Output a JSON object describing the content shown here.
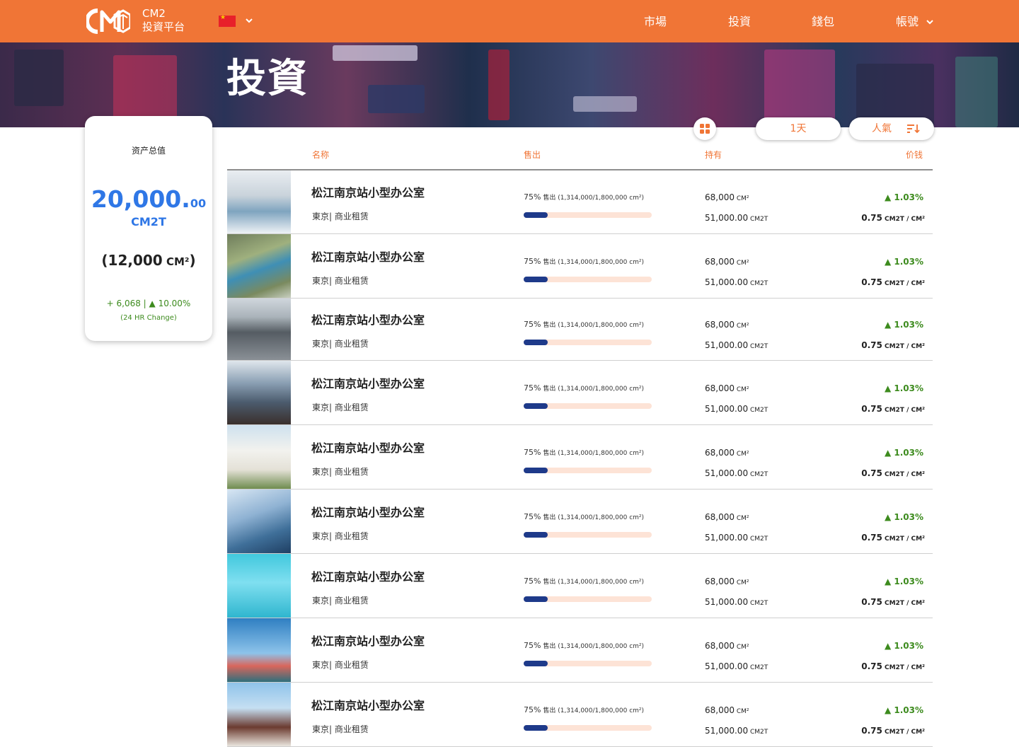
{
  "nav": {
    "brand_line1": "CM2",
    "brand_line2": "投資平台",
    "items": [
      {
        "label": "市場"
      },
      {
        "label": "投資"
      },
      {
        "label": "錢包"
      },
      {
        "label": "帳號"
      }
    ]
  },
  "hero": {
    "title": "投資"
  },
  "summary": {
    "label": "资产总值",
    "value_int": "20,000",
    "value_dot": ".",
    "value_dec": "00",
    "unit": "CM2T",
    "area_value": "(12,000",
    "area_unit": " CM²",
    "area_close": ")",
    "change_text": "+ 6,068 | ▲ 10.00%",
    "change_note": "(24 HR Change)"
  },
  "controls": {
    "period": "1天",
    "sort_label": "人氣"
  },
  "table": {
    "headers": {
      "name": "名称",
      "sold": "售出",
      "holding": "持有",
      "price": "价钱"
    },
    "rows": [
      {
        "title": "松江南京站小型办公室",
        "location": "東京| 商业租赁",
        "sold_pct": "75%",
        "sold_word": " 售出",
        "sold_detail": "  (1,314,000/1,800,000 cm²)",
        "progress": 0.19,
        "area": "68,000",
        "area_unit": " CM²",
        "tokens": "51,000.00",
        "tokens_unit": " CM2T",
        "change": "▲ 1.03%",
        "price": "0.75",
        "price_unit": " CM2T / CM²"
      },
      {
        "title": "松江南京站小型办公室",
        "location": "東京| 商业租赁",
        "sold_pct": "75%",
        "sold_word": " 售出",
        "sold_detail": "  (1,314,000/1,800,000 cm²)",
        "progress": 0.19,
        "area": "68,000",
        "area_unit": " CM²",
        "tokens": "51,000.00",
        "tokens_unit": " CM2T",
        "change": "▲ 1.03%",
        "price": "0.75",
        "price_unit": " CM2T / CM²"
      },
      {
        "title": "松江南京站小型办公室",
        "location": "東京| 商业租赁",
        "sold_pct": "75%",
        "sold_word": " 售出",
        "sold_detail": "  (1,314,000/1,800,000 cm²)",
        "progress": 0.19,
        "area": "68,000",
        "area_unit": " CM²",
        "tokens": "51,000.00",
        "tokens_unit": " CM2T",
        "change": "▲ 1.03%",
        "price": "0.75",
        "price_unit": " CM2T / CM²"
      },
      {
        "title": "松江南京站小型办公室",
        "location": "東京| 商业租赁",
        "sold_pct": "75%",
        "sold_word": " 售出",
        "sold_detail": "  (1,314,000/1,800,000 cm²)",
        "progress": 0.19,
        "area": "68,000",
        "area_unit": " CM²",
        "tokens": "51,000.00",
        "tokens_unit": " CM2T",
        "change": "▲ 1.03%",
        "price": "0.75",
        "price_unit": " CM2T / CM²"
      },
      {
        "title": "松江南京站小型办公室",
        "location": "東京| 商业租赁",
        "sold_pct": "75%",
        "sold_word": " 售出",
        "sold_detail": "  (1,314,000/1,800,000 cm²)",
        "progress": 0.19,
        "area": "68,000",
        "area_unit": " CM²",
        "tokens": "51,000.00",
        "tokens_unit": " CM2T",
        "change": "▲ 1.03%",
        "price": "0.75",
        "price_unit": " CM2T / CM²"
      },
      {
        "title": "松江南京站小型办公室",
        "location": "東京| 商业租赁",
        "sold_pct": "75%",
        "sold_word": " 售出",
        "sold_detail": "  (1,314,000/1,800,000 cm²)",
        "progress": 0.19,
        "area": "68,000",
        "area_unit": " CM²",
        "tokens": "51,000.00",
        "tokens_unit": " CM2T",
        "change": "▲ 1.03%",
        "price": "0.75",
        "price_unit": " CM2T / CM²"
      },
      {
        "title": "松江南京站小型办公室",
        "location": "東京| 商业租赁",
        "sold_pct": "75%",
        "sold_word": " 售出",
        "sold_detail": "  (1,314,000/1,800,000 cm²)",
        "progress": 0.19,
        "area": "68,000",
        "area_unit": " CM²",
        "tokens": "51,000.00",
        "tokens_unit": " CM2T",
        "change": "▲ 1.03%",
        "price": "0.75",
        "price_unit": " CM2T / CM²"
      },
      {
        "title": "松江南京站小型办公室",
        "location": "東京| 商业租赁",
        "sold_pct": "75%",
        "sold_word": " 售出",
        "sold_detail": "  (1,314,000/1,800,000 cm²)",
        "progress": 0.19,
        "area": "68,000",
        "area_unit": " CM²",
        "tokens": "51,000.00",
        "tokens_unit": " CM2T",
        "change": "▲ 1.03%",
        "price": "0.75",
        "price_unit": " CM2T / CM²"
      },
      {
        "title": "松江南京站小型办公室",
        "location": "東京| 商业租赁",
        "sold_pct": "75%",
        "sold_word": " 售出",
        "sold_detail": "  (1,314,000/1,800,000 cm²)",
        "progress": 0.19,
        "area": "68,000",
        "area_unit": " CM²",
        "tokens": "51,000.00",
        "tokens_unit": " CM2T",
        "change": "▲ 1.03%",
        "price": "0.75",
        "price_unit": " CM2T / CM²"
      }
    ]
  },
  "colors": {
    "brand_orange": "#f07536",
    "accent_blue": "#2f77e6",
    "progress_fill": "#1e3a8a",
    "progress_track": "#fde3d6",
    "positive_green": "#3d8b1e"
  },
  "icons": {
    "logo": "cm-logo",
    "flag": "china-flag-icon",
    "view_toggle": "grid-view-icon",
    "sort": "sort-descending-icon"
  }
}
